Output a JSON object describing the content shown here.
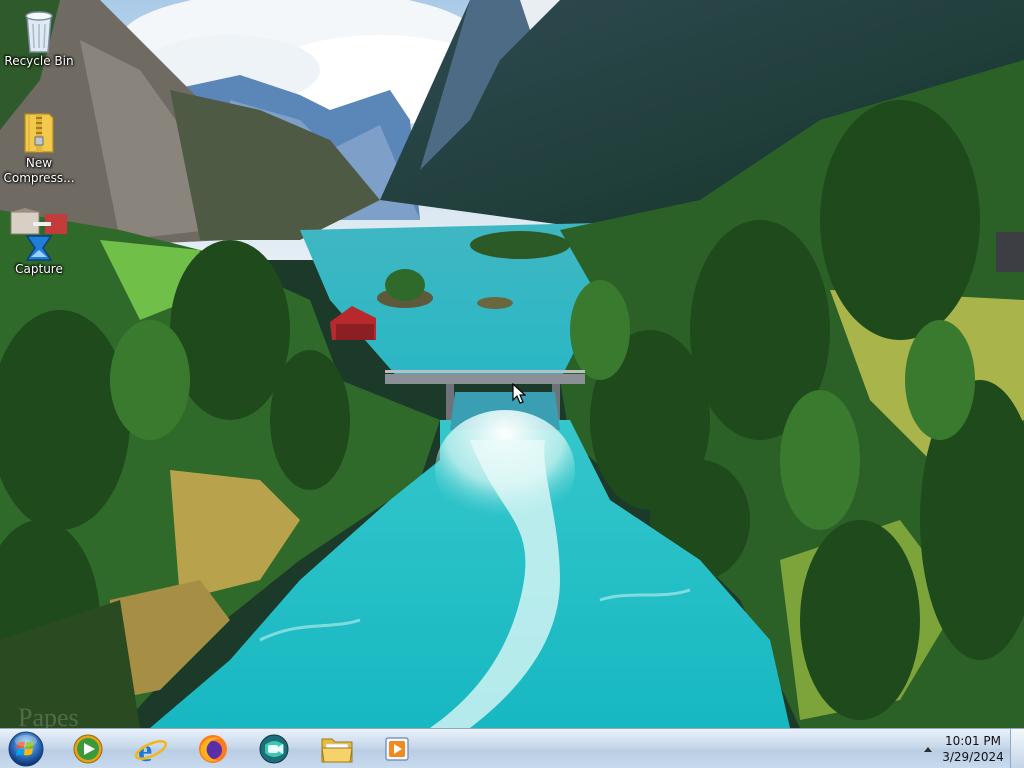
{
  "desktop": {
    "icons": [
      {
        "label": "Recycle Bin",
        "icon": "recycle-bin-icon"
      },
      {
        "label": "New\nCompress...",
        "icon": "zip-folder-icon"
      },
      {
        "label": "Capture",
        "icon": "capture-app-icon"
      }
    ],
    "watermark": "Papes"
  },
  "taskbar": {
    "start": {
      "icon": "windows-start-orb-icon"
    },
    "pinned": [
      {
        "name": "Windows Media Player",
        "icon": "media-player-icon"
      },
      {
        "name": "Internet Explorer",
        "icon": "internet-explorer-icon"
      },
      {
        "name": "Firefox",
        "icon": "firefox-icon"
      },
      {
        "name": "Meet",
        "icon": "meet-app-icon"
      },
      {
        "name": "Windows Explorer",
        "icon": "folder-explorer-icon"
      },
      {
        "name": "Video",
        "icon": "video-player-icon"
      }
    ],
    "tray": {
      "show_hidden_icon": "tray-up-arrow-icon",
      "time": "10:01 PM",
      "date": "3/29/2024"
    }
  },
  "colors": {
    "taskbar_top": "#eaf2fb",
    "taskbar_bottom": "#c8daee",
    "river": "#2cc7cc",
    "sky": "#cfe4f2"
  }
}
